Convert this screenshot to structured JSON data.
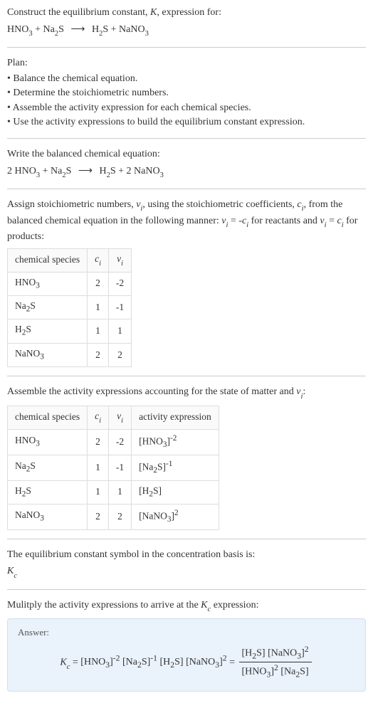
{
  "header": {
    "line1": "Construct the equilibrium constant, ",
    "K": "K",
    "line1b": ", expression for:",
    "eq_lhs_a": "HNO",
    "eq_lhs_a_sub": "3",
    "plus": " + ",
    "eq_lhs_b": "Na",
    "eq_lhs_b_sub": "2",
    "eq_lhs_b2": "S",
    "arrow": "⟶",
    "eq_rhs_a": "H",
    "eq_rhs_a_sub": "2",
    "eq_rhs_a2": "S",
    "eq_rhs_b": "NaNO",
    "eq_rhs_b_sub": "3"
  },
  "plan": {
    "title": "Plan:",
    "items": [
      "• Balance the chemical equation.",
      "• Determine the stoichiometric numbers.",
      "• Assemble the activity expression for each chemical species.",
      "• Use the activity expressions to build the equilibrium constant expression."
    ]
  },
  "balanced": {
    "title": "Write the balanced chemical equation:",
    "c1": "2 ",
    "c2": "2 "
  },
  "assign": {
    "text_a": "Assign stoichiometric numbers, ",
    "nu": "ν",
    "sub_i": "i",
    "text_b": ", using the stoichiometric coefficients, ",
    "c": "c",
    "text_c": ", from the balanced chemical equation in the following manner: ",
    "eq1_lhs": "ν",
    "eq1_rhs_pre": " = -",
    "text_d": " for reactants and ",
    "eq2_rhs_pre": " = ",
    "text_e": " for products:"
  },
  "table1": {
    "headers": [
      "chemical species",
      "c_i",
      "ν_i"
    ],
    "rows": [
      {
        "species_html": "HNO<sub>3</sub>",
        "c": "2",
        "nu": "-2"
      },
      {
        "species_html": "Na<sub>2</sub>S",
        "c": "1",
        "nu": "-1"
      },
      {
        "species_html": "H<sub>2</sub>S",
        "c": "1",
        "nu": "1"
      },
      {
        "species_html": "NaNO<sub>3</sub>",
        "c": "2",
        "nu": "2"
      }
    ]
  },
  "assemble": {
    "text": "Assemble the activity expressions accounting for the state of matter and ",
    "colon": ":"
  },
  "table2": {
    "headers": [
      "chemical species",
      "c_i",
      "ν_i",
      "activity expression"
    ],
    "rows": [
      {
        "species_html": "HNO<sub>3</sub>",
        "c": "2",
        "nu": "-2",
        "act_html": "[HNO<sub>3</sub>]<sup>-2</sup>"
      },
      {
        "species_html": "Na<sub>2</sub>S",
        "c": "1",
        "nu": "-1",
        "act_html": "[Na<sub>2</sub>S]<sup>-1</sup>"
      },
      {
        "species_html": "H<sub>2</sub>S",
        "c": "1",
        "nu": "1",
        "act_html": "[H<sub>2</sub>S]"
      },
      {
        "species_html": "NaNO<sub>3</sub>",
        "c": "2",
        "nu": "2",
        "act_html": "[NaNO<sub>3</sub>]<sup>2</sup>"
      }
    ]
  },
  "symbol": {
    "text": "The equilibrium constant symbol in the concentration basis is:",
    "Kc_pre": "K",
    "Kc_sub": "c"
  },
  "multiply": {
    "text_a": "Mulitply the activity expressions to arrive at the ",
    "text_b": " expression:"
  },
  "answer": {
    "label": "Answer:",
    "lhs_pre": "K",
    "lhs_sub": "c",
    "eq": " = ",
    "prod_html": "[HNO<sub>3</sub>]<sup>-2</sup> [Na<sub>2</sub>S]<sup>-1</sup> [H<sub>2</sub>S] [NaNO<sub>3</sub>]<sup>2</sup>",
    "frac_num_html": "[H<sub>2</sub>S] [NaNO<sub>3</sub>]<sup>2</sup>",
    "frac_den_html": "[HNO<sub>3</sub>]<sup>2</sup> [Na<sub>2</sub>S]"
  },
  "chart_data": {
    "type": "table",
    "tables": [
      {
        "title": "Stoichiometric numbers",
        "columns": [
          "chemical species",
          "c_i",
          "ν_i"
        ],
        "rows": [
          [
            "HNO3",
            2,
            -2
          ],
          [
            "Na2S",
            1,
            -1
          ],
          [
            "H2S",
            1,
            1
          ],
          [
            "NaNO3",
            2,
            2
          ]
        ]
      },
      {
        "title": "Activity expressions",
        "columns": [
          "chemical species",
          "c_i",
          "ν_i",
          "activity expression"
        ],
        "rows": [
          [
            "HNO3",
            2,
            -2,
            "[HNO3]^-2"
          ],
          [
            "Na2S",
            1,
            -1,
            "[Na2S]^-1"
          ],
          [
            "H2S",
            1,
            1,
            "[H2S]"
          ],
          [
            "NaNO3",
            2,
            2,
            "[NaNO3]^2"
          ]
        ]
      }
    ]
  }
}
